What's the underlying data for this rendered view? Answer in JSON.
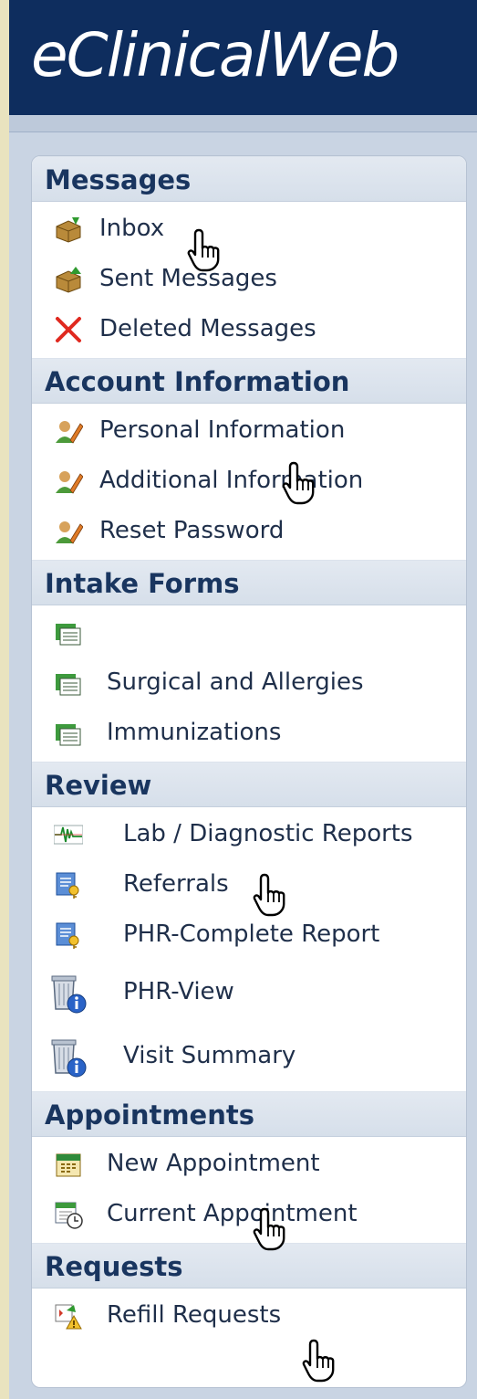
{
  "app": {
    "title": "eClinicalWeb"
  },
  "sections": [
    {
      "title": "Messages",
      "items": [
        {
          "label": "Inbox",
          "icon": "inbox-box-icon"
        },
        {
          "label": "Sent Messages",
          "icon": "sent-box-icon"
        },
        {
          "label": "Deleted Messages",
          "icon": "red-x-icon"
        }
      ]
    },
    {
      "title": "Account Information",
      "items": [
        {
          "label": "Personal Information",
          "icon": "user-edit-icon"
        },
        {
          "label": "Additional Information",
          "icon": "user-edit-icon"
        },
        {
          "label": "Reset Password",
          "icon": "user-edit-icon"
        }
      ]
    },
    {
      "title": "Intake Forms",
      "items": [
        {
          "label": "",
          "icon": "form-folder-icon"
        },
        {
          "label": "Surgical and Allergies",
          "icon": "form-folder-icon"
        },
        {
          "label": "Immunizations",
          "icon": "form-folder-icon"
        }
      ]
    },
    {
      "title": "Review",
      "items": [
        {
          "label": "Lab / Diagnostic Reports",
          "icon": "ecg-icon"
        },
        {
          "label": "Referrals",
          "icon": "report-key-icon"
        },
        {
          "label": "PHR-Complete Report",
          "icon": "report-key-icon"
        },
        {
          "label": "PHR-View",
          "icon": "trash-info-icon"
        },
        {
          "label": "Visit Summary",
          "icon": "trash-info-icon"
        }
      ]
    },
    {
      "title": "Appointments",
      "items": [
        {
          "label": "New Appointment",
          "icon": "calendar-icon"
        },
        {
          "label": "Current Appointment",
          "icon": "calendar-clock-icon"
        }
      ]
    },
    {
      "title": "Requests",
      "items": [
        {
          "label": "Refill Requests",
          "icon": "refill-request-icon"
        }
      ]
    }
  ]
}
